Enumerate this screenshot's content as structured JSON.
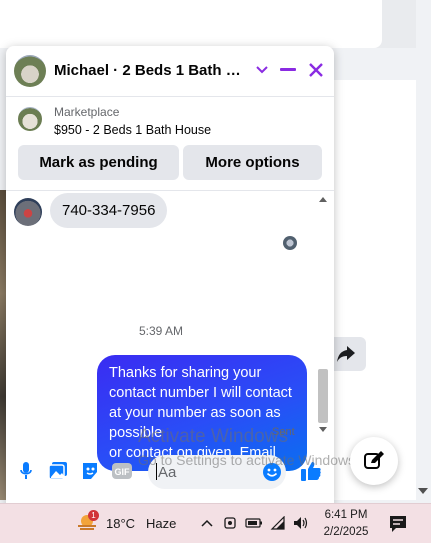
{
  "chat": {
    "title": "Michael · 2 Beds 1 Bath Ho...",
    "header_icons": [
      "chevron-down-icon",
      "minimize-icon",
      "close-icon"
    ],
    "marketplace": {
      "label": "Marketplace",
      "listing": "$950 - 2 Beds 1 Bath House"
    },
    "actions": {
      "mark_pending": "Mark as pending",
      "more_options": "More options"
    },
    "messages": {
      "incoming_text": "740-334-7956",
      "timestamp": "5:39 AM",
      "outgoing_text": "Thanks for sharing your contact number I will contact at your number as soon as possible\nor contact on given  Email",
      "status": "Sent"
    },
    "composer": {
      "placeholder": "Aa",
      "icons": [
        "microphone-icon",
        "photo-icon",
        "sticker-icon",
        "gif-icon",
        "emoji-icon",
        "thumbs-up-icon"
      ]
    },
    "accent_color": "#8a2be2",
    "bubble_gradient": [
      "#3a2cf2",
      "#0a6ff0"
    ]
  },
  "watermark": {
    "line1": "Activate Windows",
    "line2": "Go to Settings to activate Windows."
  },
  "taskbar": {
    "weather_badge": "1",
    "temperature": "18°C",
    "condition": "Haze",
    "time": "6:41 PM",
    "date": "2/2/2025",
    "tray_icons": [
      "chevron-up-icon",
      "webcam-icon",
      "battery-icon",
      "wifi-icon",
      "volume-icon",
      "notification-icon"
    ]
  }
}
